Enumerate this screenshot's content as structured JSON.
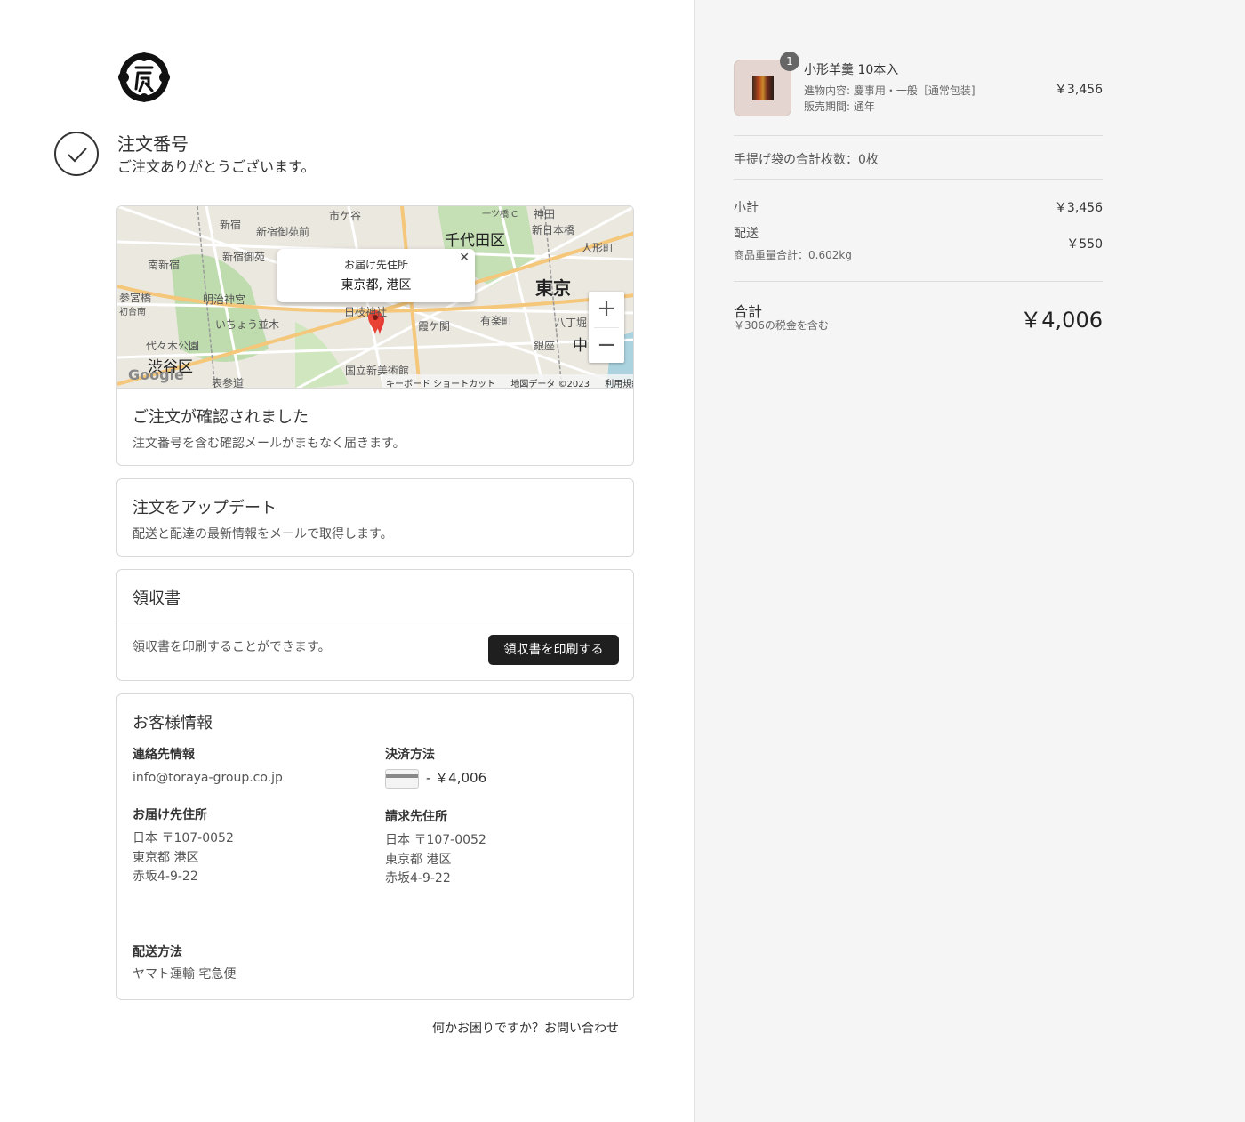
{
  "header": {
    "order_title": "注文番号",
    "thanks": "ご注文ありがとうございます。"
  },
  "map": {
    "popup_title": "お届け先住所",
    "popup_address": "東京都, 港区",
    "labels": [
      "新宿",
      "新宿御苑前",
      "市ケ谷",
      "千代田区",
      "神田",
      "新日本橋",
      "人形町",
      "南新宿",
      "新宿御苑",
      "参宮橋",
      "初台南",
      "明治神宮",
      "日枝神社",
      "東京",
      "いちょう並木",
      "霞ケ関",
      "有楽町",
      "八丁堀",
      "代々木公園",
      "銀座",
      "中",
      "渋谷区",
      "国立新美術館",
      "表参道",
      "一ツ橋IC"
    ],
    "zoom_in": "+",
    "zoom_out": "−",
    "footer": [
      "キーボード ショートカット",
      "地図データ ©2023",
      "利用規約"
    ],
    "google": "Google"
  },
  "confirmed": {
    "title": "ご注文が確認されました",
    "text": "注文番号を含む確認メールがまもなく届きます。"
  },
  "update": {
    "title": "注文をアップデート",
    "text": "配送と配達の最新情報をメールで取得します。"
  },
  "receipt": {
    "title": "領収書",
    "text": "領収書を印刷することができます。",
    "button": "領収書を印刷する"
  },
  "customer": {
    "title": "お客様情報",
    "contact_label": "連絡先情報",
    "contact_value": "info@toraya-group.co.jp",
    "payment_label": "決済方法",
    "payment_value": "- ￥4,006",
    "shipping_label": "お届け先住所",
    "shipping_lines": [
      "日本 〒107-0052",
      "東京都 港区",
      "赤坂4-9-22"
    ],
    "billing_label": "請求先住所",
    "billing_lines": [
      "日本 〒107-0052",
      "東京都 港区",
      "赤坂4-9-22"
    ],
    "method_label": "配送方法",
    "method_value": "ヤマト運輸 宅急便"
  },
  "help": "何かお困りですか？お問い合わせ",
  "summary": {
    "item": {
      "qty": "1",
      "name": "小形羊羹 10本入",
      "detail1": "進物内容: 慶事用・一般［通常包装]",
      "detail2": "販売期間: 通年",
      "price": "￥3,456"
    },
    "bags": "手提げ袋の合計枚数：0枚",
    "subtotal_label": "小計",
    "subtotal": "￥3,456",
    "shipping_label": "配送",
    "shipping": "￥550",
    "weight": "商品重量合計：0.602kg",
    "total_label": "合計",
    "tax": "￥306の税金を含む",
    "total": "￥4,006"
  }
}
